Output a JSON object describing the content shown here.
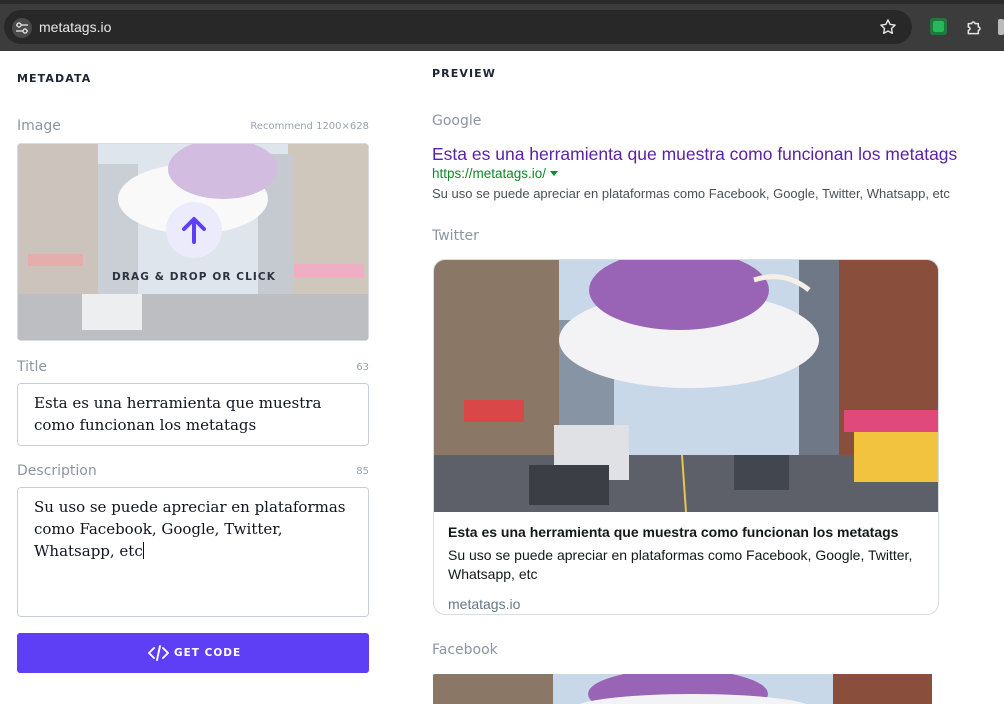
{
  "browser": {
    "url": "metatags.io"
  },
  "metadata": {
    "heading": "METADATA",
    "image": {
      "label": "Image",
      "recommend": "Recommend 1200×628",
      "drop_text": "DRAG & DROP OR CLICK"
    },
    "title": {
      "label": "Title",
      "count": "63",
      "value_line1": "Esta es una herramienta que muestra",
      "value_line2": "como funcionan los metatags"
    },
    "description": {
      "label": "Description",
      "count": "85",
      "value_line1": "Su uso se puede apreciar en plataformas",
      "value_line2": "como Facebook, Google, Twitter,",
      "value_line3": "Whatsapp, etc"
    },
    "get_code_label": "GET CODE"
  },
  "preview": {
    "heading": "PREVIEW",
    "google": {
      "label": "Google",
      "title": "Esta es una herramienta que muestra como funcionan los metatags",
      "url": "https://metatags.io/",
      "description": "Su uso se puede apreciar en plataformas como Facebook, Google, Twitter, Whatsapp, etc"
    },
    "twitter": {
      "label": "Twitter",
      "title": "Esta es una herramienta que muestra como funcionan los metatags",
      "description": "Su uso se puede apreciar en plataformas como Facebook, Google, Twitter, Whatsapp, etc",
      "domain": "metatags.io"
    },
    "facebook": {
      "label": "Facebook"
    }
  },
  "colors": {
    "accent": "#5f3ff5",
    "google_title": "#5b1fa8",
    "google_url": "#0e8a2b"
  }
}
